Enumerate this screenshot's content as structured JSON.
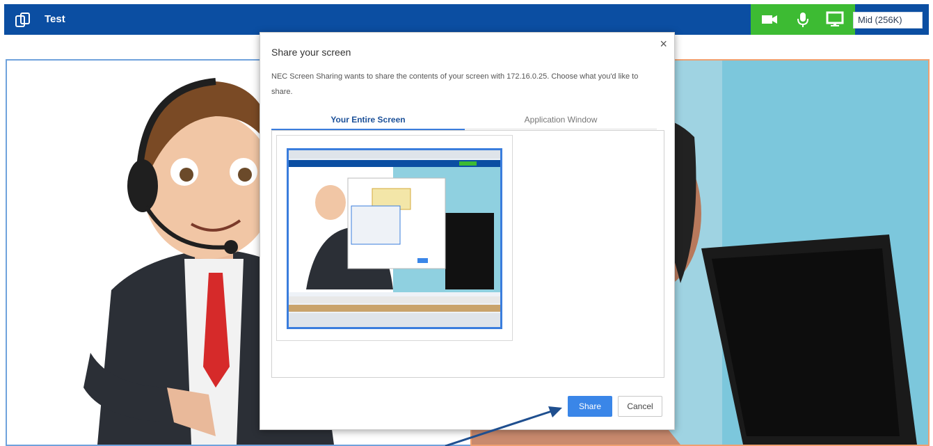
{
  "header": {
    "title": "Test",
    "bandwidth_value": "Mid (256K)",
    "colors": {
      "bar": "#0b4ea2",
      "controls": "#3dbb33"
    },
    "icons": [
      "video-camera-icon",
      "microphone-icon",
      "screen-share-icon"
    ]
  },
  "dialog": {
    "title": "Share your screen",
    "description": "NEC Screen Sharing wants to share the contents of your screen with 172.16.0.25. Choose what you'd like to share.",
    "tabs": [
      "Your Entire Screen",
      "Application Window"
    ],
    "share_label": "Share",
    "cancel_label": "Cancel",
    "close_glyph": "×"
  }
}
